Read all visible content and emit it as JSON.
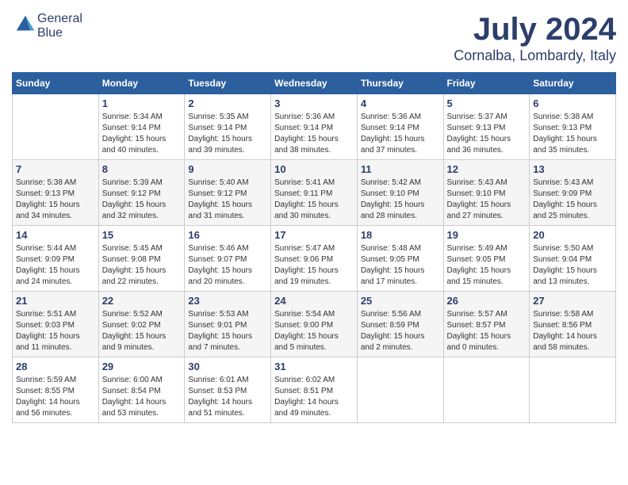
{
  "header": {
    "logo_general": "General",
    "logo_blue": "Blue",
    "month_title": "July 2024",
    "location": "Cornalba, Lombardy, Italy"
  },
  "columns": [
    "Sunday",
    "Monday",
    "Tuesday",
    "Wednesday",
    "Thursday",
    "Friday",
    "Saturday"
  ],
  "weeks": [
    {
      "days": [
        {
          "number": "",
          "info": ""
        },
        {
          "number": "1",
          "info": "Sunrise: 5:34 AM\nSunset: 9:14 PM\nDaylight: 15 hours\nand 40 minutes."
        },
        {
          "number": "2",
          "info": "Sunrise: 5:35 AM\nSunset: 9:14 PM\nDaylight: 15 hours\nand 39 minutes."
        },
        {
          "number": "3",
          "info": "Sunrise: 5:36 AM\nSunset: 9:14 PM\nDaylight: 15 hours\nand 38 minutes."
        },
        {
          "number": "4",
          "info": "Sunrise: 5:36 AM\nSunset: 9:14 PM\nDaylight: 15 hours\nand 37 minutes."
        },
        {
          "number": "5",
          "info": "Sunrise: 5:37 AM\nSunset: 9:13 PM\nDaylight: 15 hours\nand 36 minutes."
        },
        {
          "number": "6",
          "info": "Sunrise: 5:38 AM\nSunset: 9:13 PM\nDaylight: 15 hours\nand 35 minutes."
        }
      ]
    },
    {
      "days": [
        {
          "number": "7",
          "info": "Sunrise: 5:38 AM\nSunset: 9:13 PM\nDaylight: 15 hours\nand 34 minutes."
        },
        {
          "number": "8",
          "info": "Sunrise: 5:39 AM\nSunset: 9:12 PM\nDaylight: 15 hours\nand 32 minutes."
        },
        {
          "number": "9",
          "info": "Sunrise: 5:40 AM\nSunset: 9:12 PM\nDaylight: 15 hours\nand 31 minutes."
        },
        {
          "number": "10",
          "info": "Sunrise: 5:41 AM\nSunset: 9:11 PM\nDaylight: 15 hours\nand 30 minutes."
        },
        {
          "number": "11",
          "info": "Sunrise: 5:42 AM\nSunset: 9:10 PM\nDaylight: 15 hours\nand 28 minutes."
        },
        {
          "number": "12",
          "info": "Sunrise: 5:43 AM\nSunset: 9:10 PM\nDaylight: 15 hours\nand 27 minutes."
        },
        {
          "number": "13",
          "info": "Sunrise: 5:43 AM\nSunset: 9:09 PM\nDaylight: 15 hours\nand 25 minutes."
        }
      ]
    },
    {
      "days": [
        {
          "number": "14",
          "info": "Sunrise: 5:44 AM\nSunset: 9:09 PM\nDaylight: 15 hours\nand 24 minutes."
        },
        {
          "number": "15",
          "info": "Sunrise: 5:45 AM\nSunset: 9:08 PM\nDaylight: 15 hours\nand 22 minutes."
        },
        {
          "number": "16",
          "info": "Sunrise: 5:46 AM\nSunset: 9:07 PM\nDaylight: 15 hours\nand 20 minutes."
        },
        {
          "number": "17",
          "info": "Sunrise: 5:47 AM\nSunset: 9:06 PM\nDaylight: 15 hours\nand 19 minutes."
        },
        {
          "number": "18",
          "info": "Sunrise: 5:48 AM\nSunset: 9:05 PM\nDaylight: 15 hours\nand 17 minutes."
        },
        {
          "number": "19",
          "info": "Sunrise: 5:49 AM\nSunset: 9:05 PM\nDaylight: 15 hours\nand 15 minutes."
        },
        {
          "number": "20",
          "info": "Sunrise: 5:50 AM\nSunset: 9:04 PM\nDaylight: 15 hours\nand 13 minutes."
        }
      ]
    },
    {
      "days": [
        {
          "number": "21",
          "info": "Sunrise: 5:51 AM\nSunset: 9:03 PM\nDaylight: 15 hours\nand 11 minutes."
        },
        {
          "number": "22",
          "info": "Sunrise: 5:52 AM\nSunset: 9:02 PM\nDaylight: 15 hours\nand 9 minutes."
        },
        {
          "number": "23",
          "info": "Sunrise: 5:53 AM\nSunset: 9:01 PM\nDaylight: 15 hours\nand 7 minutes."
        },
        {
          "number": "24",
          "info": "Sunrise: 5:54 AM\nSunset: 9:00 PM\nDaylight: 15 hours\nand 5 minutes."
        },
        {
          "number": "25",
          "info": "Sunrise: 5:56 AM\nSunset: 8:59 PM\nDaylight: 15 hours\nand 2 minutes."
        },
        {
          "number": "26",
          "info": "Sunrise: 5:57 AM\nSunset: 8:57 PM\nDaylight: 15 hours\nand 0 minutes."
        },
        {
          "number": "27",
          "info": "Sunrise: 5:58 AM\nSunset: 8:56 PM\nDaylight: 14 hours\nand 58 minutes."
        }
      ]
    },
    {
      "days": [
        {
          "number": "28",
          "info": "Sunrise: 5:59 AM\nSunset: 8:55 PM\nDaylight: 14 hours\nand 56 minutes."
        },
        {
          "number": "29",
          "info": "Sunrise: 6:00 AM\nSunset: 8:54 PM\nDaylight: 14 hours\nand 53 minutes."
        },
        {
          "number": "30",
          "info": "Sunrise: 6:01 AM\nSunset: 8:53 PM\nDaylight: 14 hours\nand 51 minutes."
        },
        {
          "number": "31",
          "info": "Sunrise: 6:02 AM\nSunset: 8:51 PM\nDaylight: 14 hours\nand 49 minutes."
        },
        {
          "number": "",
          "info": ""
        },
        {
          "number": "",
          "info": ""
        },
        {
          "number": "",
          "info": ""
        }
      ]
    }
  ]
}
